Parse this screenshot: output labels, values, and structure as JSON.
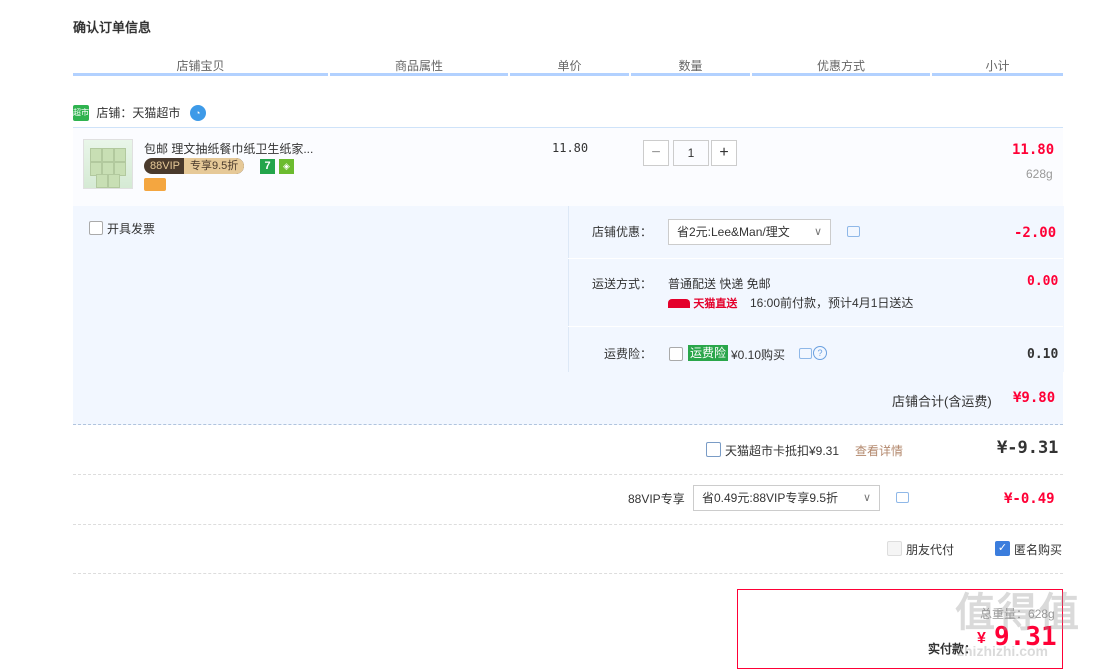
{
  "page_title": "确认订单信息",
  "columns": [
    "店铺宝贝",
    "商品属性",
    "单价",
    "数量",
    "优惠方式",
    "小计"
  ],
  "shop": {
    "label": "店铺：",
    "name": "天猫超市"
  },
  "item": {
    "title": "包邮 理文抽纸餐巾纸卫生纸家...",
    "vip_tag": "88VIP",
    "vip_discount": "专享9.5折",
    "badge_seven": "7",
    "unit_price": "11.80",
    "quantity": "1",
    "minus": "−",
    "plus": "+",
    "subtotal": "11.80",
    "weight": "628g"
  },
  "invoice": {
    "label": "开具发票"
  },
  "shop_discount": {
    "label": "店铺优惠：",
    "selected": "省2元:Lee&Man/理文",
    "amount": "-2.00"
  },
  "shipping": {
    "label": "运送方式：",
    "method": "普通配送 快递 免邮",
    "tmall_direct": "天猫直送",
    "delivery_note": "16:00前付款，预计4月1日送达",
    "amount": "0.00"
  },
  "shipping_insurance": {
    "label": "运费险：",
    "tag": "运费险",
    "price": "¥0.10购买",
    "amount": "0.10"
  },
  "shop_total": {
    "label": "店铺合计(含运费)",
    "amount": "¥9.80"
  },
  "tmall_card": {
    "label": "天猫超市卡抵扣¥9.31",
    "link": "查看详情",
    "amount": "¥-9.31"
  },
  "vip88": {
    "label": "88VIP专享",
    "selected": "省0.49元:88VIP专享9.5折",
    "amount": "¥-0.49"
  },
  "options": {
    "friend_pay": "朋友代付",
    "anonymous": "匿名购买"
  },
  "payment": {
    "weight_label": "总重量：",
    "weight_value": "628g",
    "label": "实付款：",
    "currency": "¥",
    "amount": "9.31"
  },
  "watermark": {
    "brand": "值得值",
    "domain": "zhizhizhi.com"
  },
  "colors": {
    "accent_red": "#ff0036",
    "header_line": "#b2d1ff",
    "panel_bg": "#f2f7ff",
    "checkbox_checked": "#3b7ddd"
  }
}
